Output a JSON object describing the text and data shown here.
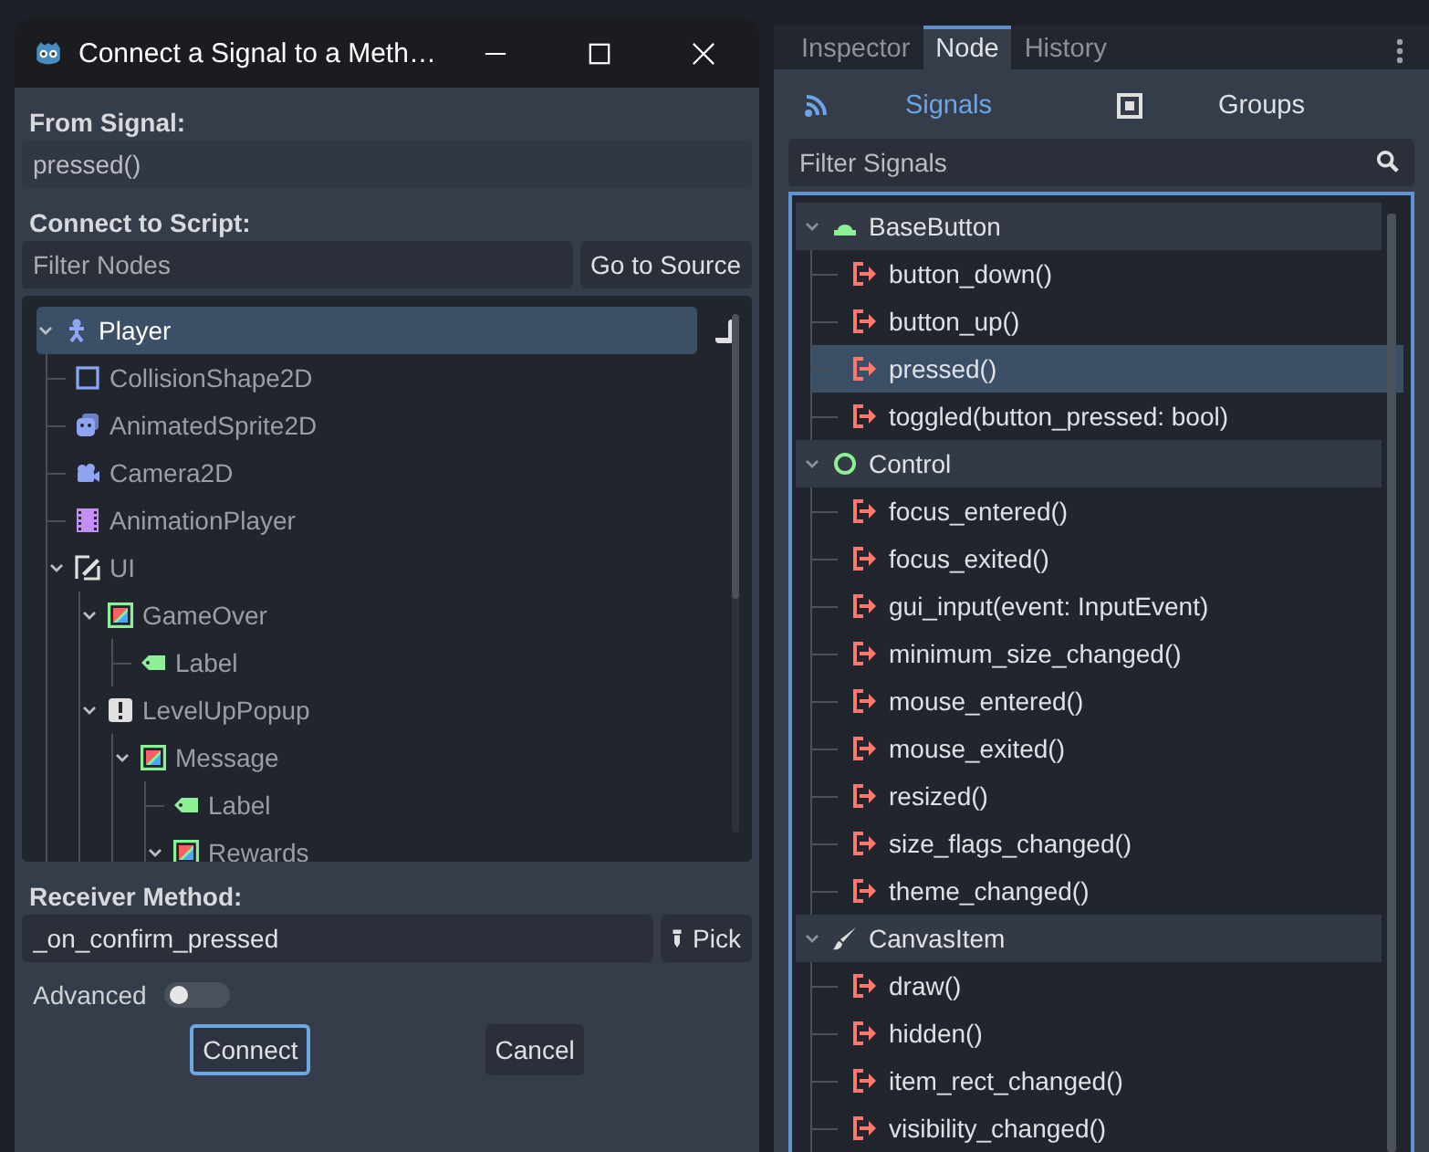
{
  "dialog": {
    "title": "Connect a Signal to a Meth…",
    "from_signal_label": "From Signal:",
    "from_signal_value": "pressed()",
    "connect_to_script_label": "Connect to Script:",
    "filter_placeholder": "Filter Nodes",
    "go_to_source_button": "Go to Source",
    "nodes": [
      {
        "name": "Player",
        "kind": "character",
        "selected": true,
        "has_script": true,
        "expanded": true,
        "children": [
          {
            "name": "CollisionShape2D",
            "kind": "shape",
            "selected": false
          },
          {
            "name": "AnimatedSprite2D",
            "kind": "sprite",
            "selected": false
          },
          {
            "name": "Camera2D",
            "kind": "camera",
            "selected": false
          },
          {
            "name": "AnimationPlayer",
            "kind": "film",
            "selected": false
          },
          {
            "name": "UI",
            "kind": "control",
            "selected": false,
            "expanded": true,
            "children": [
              {
                "name": "GameOver",
                "kind": "container",
                "selected": false,
                "expanded": true,
                "children": [
                  {
                    "name": "Label",
                    "kind": "label",
                    "selected": false
                  }
                ]
              },
              {
                "name": "LevelUpPopup",
                "kind": "popup",
                "selected": false,
                "expanded": true,
                "children": [
                  {
                    "name": "Message",
                    "kind": "container",
                    "selected": false,
                    "expanded": true,
                    "children": [
                      {
                        "name": "Label",
                        "kind": "label",
                        "selected": false
                      },
                      {
                        "name": "Rewards",
                        "kind": "container",
                        "selected": false,
                        "expanded": true
                      }
                    ]
                  }
                ]
              }
            ]
          }
        ]
      }
    ],
    "receiver_method_label": "Receiver Method:",
    "receiver_method_value": "_on_confirm_pressed",
    "pick_button": "Pick",
    "advanced": {
      "label": "Advanced",
      "on": false
    },
    "buttons": [
      {
        "label": "Connect",
        "focused": true
      },
      {
        "label": "Cancel",
        "focused": false
      }
    ]
  },
  "dock": {
    "tabs": [
      {
        "label": "Inspector",
        "selected": false
      },
      {
        "label": "Node",
        "selected": true
      },
      {
        "label": "History",
        "selected": false
      }
    ],
    "subtabs": [
      {
        "label": "Signals",
        "kind": "signals",
        "selected": true
      },
      {
        "label": "Groups",
        "kind": "groups",
        "selected": false
      }
    ],
    "filter_placeholder": "Filter Signals",
    "signal_groups": [
      {
        "name": "BaseButton",
        "kind": "button",
        "expanded": true,
        "signals": [
          {
            "name": "button_down()",
            "selected": false
          },
          {
            "name": "button_up()",
            "selected": false
          },
          {
            "name": "pressed()",
            "selected": true
          },
          {
            "name": "toggled(button_pressed: bool)",
            "selected": false
          }
        ]
      },
      {
        "name": "Control",
        "kind": "control",
        "expanded": true,
        "signals": [
          {
            "name": "focus_entered()",
            "selected": false
          },
          {
            "name": "focus_exited()",
            "selected": false
          },
          {
            "name": "gui_input(event: InputEvent)",
            "selected": false
          },
          {
            "name": "minimum_size_changed()",
            "selected": false
          },
          {
            "name": "mouse_entered()",
            "selected": false
          },
          {
            "name": "mouse_exited()",
            "selected": false
          },
          {
            "name": "resized()",
            "selected": false
          },
          {
            "name": "size_flags_changed()",
            "selected": false
          },
          {
            "name": "theme_changed()",
            "selected": false
          }
        ]
      },
      {
        "name": "CanvasItem",
        "kind": "canvas",
        "expanded": true,
        "signals": [
          {
            "name": "draw()",
            "selected": false
          },
          {
            "name": "hidden()",
            "selected": false
          },
          {
            "name": "item_rect_changed()",
            "selected": false
          },
          {
            "name": "visibility_changed()",
            "selected": false
          }
        ]
      }
    ]
  }
}
